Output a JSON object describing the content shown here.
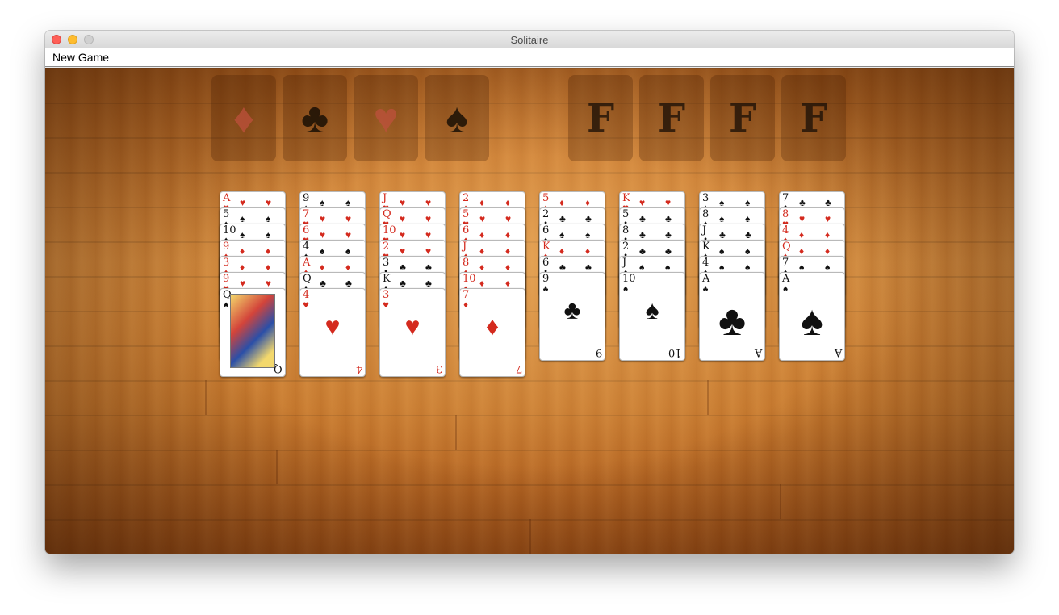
{
  "window": {
    "title": "Solitaire"
  },
  "menu": {
    "new_game": "New Game"
  },
  "foundations": [
    {
      "suit": "♦",
      "color": "red"
    },
    {
      "suit": "♣",
      "color": "black"
    },
    {
      "suit": "♥",
      "color": "red"
    },
    {
      "suit": "♠",
      "color": "black"
    }
  ],
  "freecells": [
    {
      "label": "F"
    },
    {
      "label": "F"
    },
    {
      "label": "F"
    },
    {
      "label": "F"
    }
  ],
  "tableau": [
    [
      {
        "rank": "A",
        "suit": "♥",
        "color": "red"
      },
      {
        "rank": "5",
        "suit": "♠",
        "color": "black"
      },
      {
        "rank": "10",
        "suit": "♠",
        "color": "black"
      },
      {
        "rank": "9",
        "suit": "♦",
        "color": "red"
      },
      {
        "rank": "3",
        "suit": "♦",
        "color": "red"
      },
      {
        "rank": "9",
        "suit": "♥",
        "color": "red"
      },
      {
        "rank": "Q",
        "suit": "♠",
        "color": "black"
      }
    ],
    [
      {
        "rank": "9",
        "suit": "♠",
        "color": "black"
      },
      {
        "rank": "7",
        "suit": "♥",
        "color": "red"
      },
      {
        "rank": "6",
        "suit": "♥",
        "color": "red"
      },
      {
        "rank": "4",
        "suit": "♠",
        "color": "black"
      },
      {
        "rank": "A",
        "suit": "♦",
        "color": "red"
      },
      {
        "rank": "Q",
        "suit": "♣",
        "color": "black"
      },
      {
        "rank": "4",
        "suit": "♥",
        "color": "red"
      }
    ],
    [
      {
        "rank": "J",
        "suit": "♥",
        "color": "red"
      },
      {
        "rank": "Q",
        "suit": "♥",
        "color": "red"
      },
      {
        "rank": "10",
        "suit": "♥",
        "color": "red"
      },
      {
        "rank": "2",
        "suit": "♥",
        "color": "red"
      },
      {
        "rank": "3",
        "suit": "♣",
        "color": "black"
      },
      {
        "rank": "K",
        "suit": "♣",
        "color": "black"
      },
      {
        "rank": "3",
        "suit": "♥",
        "color": "red"
      }
    ],
    [
      {
        "rank": "2",
        "suit": "♦",
        "color": "red"
      },
      {
        "rank": "5",
        "suit": "♥",
        "color": "red"
      },
      {
        "rank": "6",
        "suit": "♦",
        "color": "red"
      },
      {
        "rank": "J",
        "suit": "♦",
        "color": "red"
      },
      {
        "rank": "8",
        "suit": "♦",
        "color": "red"
      },
      {
        "rank": "10",
        "suit": "♦",
        "color": "red"
      },
      {
        "rank": "7",
        "suit": "♦",
        "color": "red"
      }
    ],
    [
      {
        "rank": "5",
        "suit": "♦",
        "color": "red"
      },
      {
        "rank": "2",
        "suit": "♣",
        "color": "black"
      },
      {
        "rank": "6",
        "suit": "♠",
        "color": "black"
      },
      {
        "rank": "K",
        "suit": "♦",
        "color": "red"
      },
      {
        "rank": "6",
        "suit": "♣",
        "color": "black"
      },
      {
        "rank": "9",
        "suit": "♣",
        "color": "black"
      }
    ],
    [
      {
        "rank": "K",
        "suit": "♥",
        "color": "red"
      },
      {
        "rank": "5",
        "suit": "♣",
        "color": "black"
      },
      {
        "rank": "8",
        "suit": "♣",
        "color": "black"
      },
      {
        "rank": "2",
        "suit": "♣",
        "color": "black"
      },
      {
        "rank": "J",
        "suit": "♠",
        "color": "black"
      },
      {
        "rank": "10",
        "suit": "♠",
        "color": "black"
      }
    ],
    [
      {
        "rank": "3",
        "suit": "♠",
        "color": "black"
      },
      {
        "rank": "8",
        "suit": "♠",
        "color": "black"
      },
      {
        "rank": "J",
        "suit": "♣",
        "color": "black"
      },
      {
        "rank": "K",
        "suit": "♠",
        "color": "black"
      },
      {
        "rank": "4",
        "suit": "♠",
        "color": "black"
      },
      {
        "rank": "A",
        "suit": "♣",
        "color": "black"
      }
    ],
    [
      {
        "rank": "7",
        "suit": "♣",
        "color": "black"
      },
      {
        "rank": "8",
        "suit": "♥",
        "color": "red"
      },
      {
        "rank": "4",
        "suit": "♦",
        "color": "red"
      },
      {
        "rank": "Q",
        "suit": "♦",
        "color": "red"
      },
      {
        "rank": "7",
        "suit": "♠",
        "color": "black"
      },
      {
        "rank": "A",
        "suit": "♠",
        "color": "black"
      }
    ]
  ]
}
